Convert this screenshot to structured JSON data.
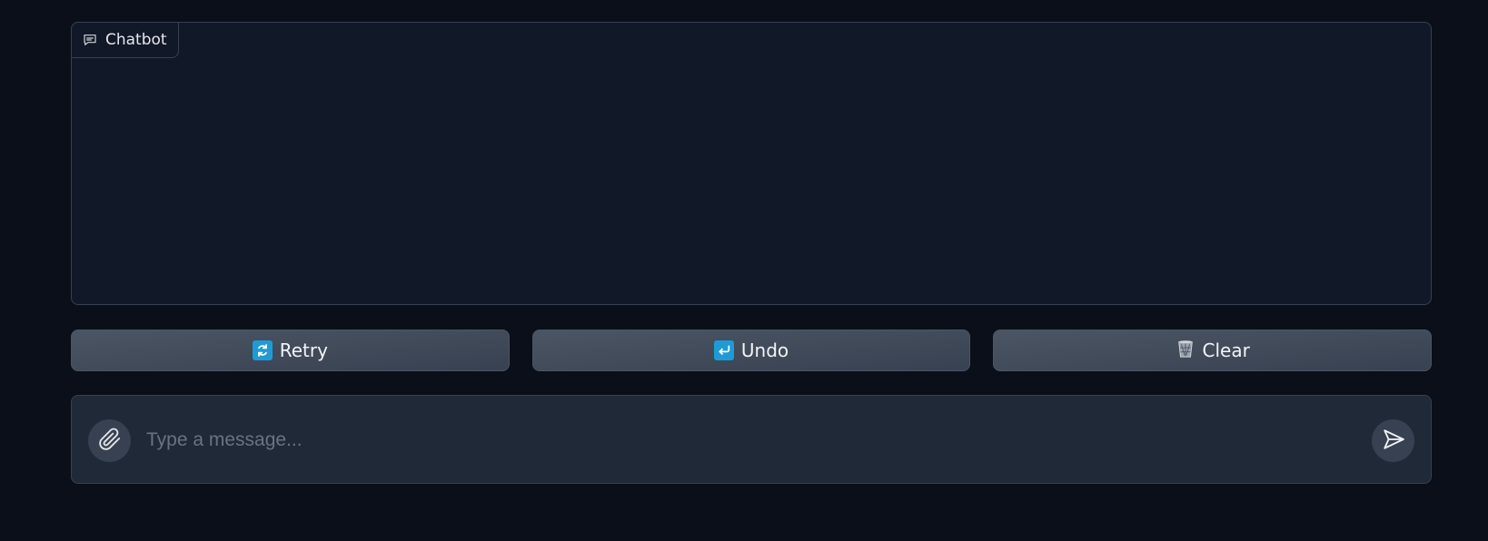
{
  "chatbot": {
    "label": "Chatbot",
    "icon": "chat-bubble-icon"
  },
  "buttons": {
    "retry": {
      "label": "Retry",
      "icon": "retry-icon"
    },
    "undo": {
      "label": "Undo",
      "icon": "undo-icon"
    },
    "clear": {
      "label": "Clear",
      "icon": "wastebasket-icon"
    }
  },
  "composer": {
    "placeholder": "Type a message...",
    "value": "",
    "attach_icon": "paperclip-icon",
    "send_icon": "send-icon"
  },
  "colors": {
    "background": "#0b0f19",
    "panel": "#111827",
    "button": "#4b5563",
    "emoji_blue": "#1e9bd7"
  }
}
